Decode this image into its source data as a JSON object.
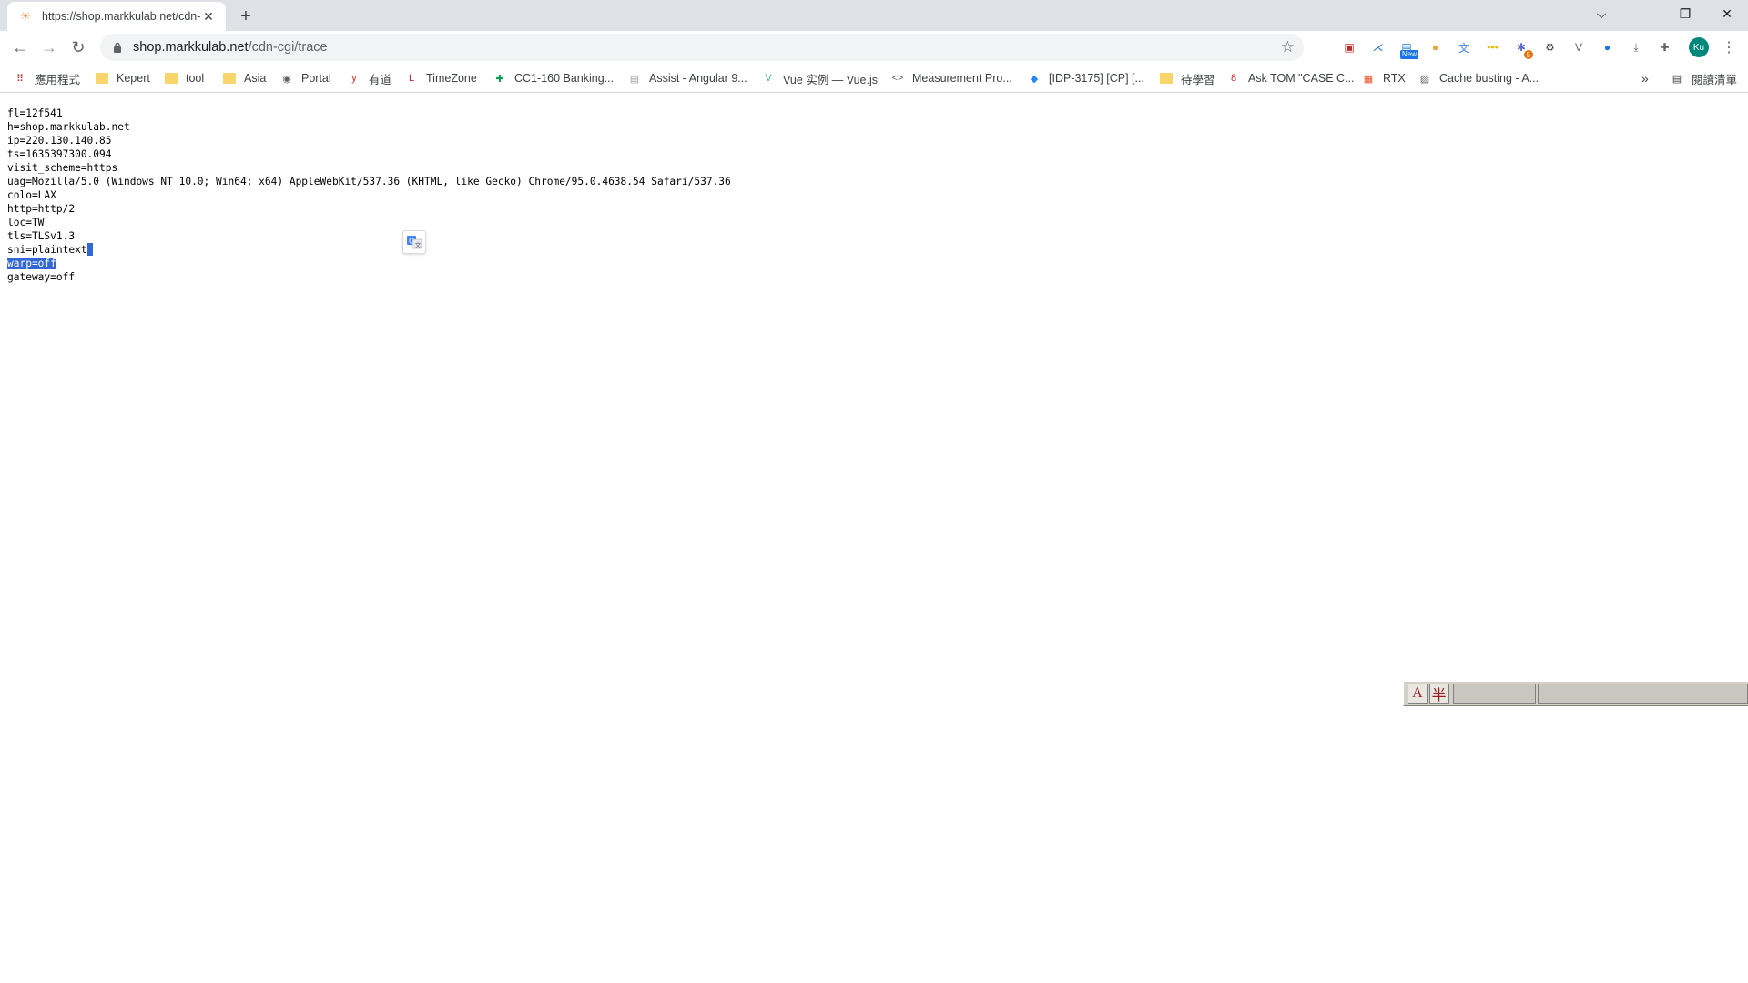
{
  "tab": {
    "title": "https://shop.markkulab.net/cdn-cgi/trace",
    "close": "✕",
    "new_tab": "+"
  },
  "window_controls": {
    "tab_search": "⌵",
    "minimize": "—",
    "restore": "❐",
    "close": "✕"
  },
  "toolbar": {
    "back": "←",
    "forward": "→",
    "reload": "↻",
    "url_host": "shop.markkulab.net",
    "url_path": "/cdn-cgi/trace",
    "bookmark_star": "☆",
    "extensions": [
      {
        "name": "flag-extension",
        "glyph": "▣",
        "color": "#c62828"
      },
      {
        "name": "compass-extension",
        "glyph": "⋌",
        "color": "#1a73e8"
      },
      {
        "name": "new-extension",
        "glyph": "▤",
        "color": "#1a73e8",
        "badge": "New"
      },
      {
        "name": "cookie-extension",
        "glyph": "●",
        "color": "#e8a33d"
      },
      {
        "name": "translate-extension",
        "glyph": "文",
        "color": "#4285f4"
      },
      {
        "name": "password-extension",
        "glyph": "•••",
        "color": "#f4b400"
      },
      {
        "name": "dev-extension",
        "glyph": "✱",
        "color": "#5b6bd6",
        "badge": "5"
      },
      {
        "name": "settings-extension",
        "glyph": "⚙",
        "color": "#3c4043"
      },
      {
        "name": "vue-extension",
        "glyph": "V",
        "color": "#5f6368"
      },
      {
        "name": "vpn-extension",
        "glyph": "●",
        "color": "#1a73e8"
      },
      {
        "name": "download-extension",
        "glyph": "⤓",
        "color": "#5f6368"
      },
      {
        "name": "puzzle-extension",
        "glyph": "✚",
        "color": "#5f6368"
      }
    ],
    "avatar": "Ku",
    "menu": "⋮"
  },
  "bookmarks": [
    {
      "label": "應用程式",
      "icon": "apps-grid-icon",
      "glyph": "⠿",
      "color": "#d93025"
    },
    {
      "label": "Kepert",
      "icon": "folder-icon"
    },
    {
      "label": "tool",
      "icon": "folder-icon"
    },
    {
      "label": "Asia",
      "icon": "folder-icon"
    },
    {
      "label": "Portal",
      "icon": "globe-icon",
      "glyph": "◉",
      "color": "#5f6368"
    },
    {
      "label": "有道",
      "icon": "youdao-icon",
      "glyph": "y",
      "color": "#d93025"
    },
    {
      "label": "TimeZone",
      "icon": "timezone-icon",
      "glyph": "L",
      "color": "#c2185b"
    },
    {
      "label": "CC1-160 Banking...",
      "icon": "sheets-icon",
      "glyph": "✚",
      "color": "#0f9d58"
    },
    {
      "label": "Assist - Angular 9...",
      "icon": "page-icon",
      "glyph": "▤",
      "color": "#9aa0a6"
    },
    {
      "label": "Vue 实例 — Vue.js",
      "icon": "vue-icon",
      "glyph": "V",
      "color": "#41b883"
    },
    {
      "label": "Measurement Pro...",
      "icon": "code-icon",
      "glyph": "<>",
      "color": "#5f6368"
    },
    {
      "label": "[IDP-3175] [CP] [...",
      "icon": "jira-icon",
      "glyph": "◆",
      "color": "#2684ff"
    },
    {
      "label": "待學習",
      "icon": "folder-icon"
    },
    {
      "label": "Ask TOM \"CASE C...",
      "icon": "oracle-icon",
      "glyph": "8",
      "color": "#c62828"
    },
    {
      "label": "RTX",
      "icon": "microsoft-icon",
      "glyph": "▦",
      "color": "#f25022"
    },
    {
      "label": "Cache busting - A...",
      "icon": "image-icon",
      "glyph": "▨",
      "color": "#5f6368"
    }
  ],
  "bookmarks_overflow": "»",
  "reading_list": {
    "label": "閱讀清單",
    "glyph": "▤"
  },
  "trace_lines": [
    "fl=12f541",
    "h=shop.markkulab.net",
    "ip=220.130.140.85",
    "ts=1635397300.094",
    "visit_scheme=https",
    "uag=Mozilla/5.0 (Windows NT 10.0; Win64; x64) AppleWebKit/537.36 (KHTML, like Gecko) Chrome/95.0.4638.54 Safari/537.36",
    "colo=LAX",
    "http=http/2",
    "loc=TW",
    "tls=TLSv1.3",
    "sni=plaintext",
    "warp=off",
    "gateway=off"
  ],
  "selected_line": "warp=off",
  "ime": {
    "mode_a": "A",
    "mode_b": "半"
  }
}
